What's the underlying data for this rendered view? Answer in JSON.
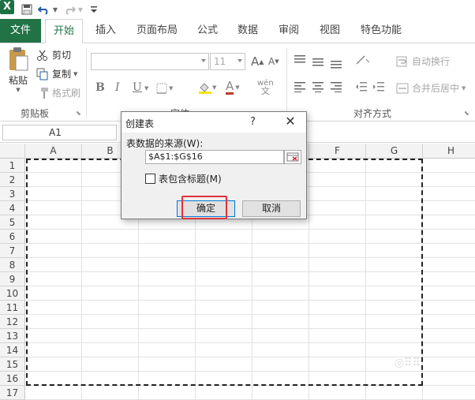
{
  "app": {
    "logo_letter": "X"
  },
  "qat": {
    "undo_icon": "undo-icon",
    "redo_icon": "redo-icon"
  },
  "tabs": [
    {
      "id": "file",
      "label": "文件"
    },
    {
      "id": "home",
      "label": "开始"
    },
    {
      "id": "insert",
      "label": "插入"
    },
    {
      "id": "layout",
      "label": "页面布局"
    },
    {
      "id": "formula",
      "label": "公式"
    },
    {
      "id": "data",
      "label": "数据"
    },
    {
      "id": "review",
      "label": "审阅"
    },
    {
      "id": "view",
      "label": "视图"
    },
    {
      "id": "special",
      "label": "特色功能"
    }
  ],
  "ribbon": {
    "clipboard": {
      "paste": "粘贴",
      "cut": "剪切",
      "copy": "复制",
      "format_painter": "格式刷",
      "label": "剪贴板"
    },
    "font": {
      "size": "11",
      "bold": "B",
      "italic": "I",
      "underline": "U",
      "grow": "A",
      "shrink": "A",
      "font_color": "A",
      "wen": "wén",
      "label": "字体"
    },
    "alignment": {
      "wrap": "自动换行",
      "merge": "合并后居中",
      "label": "对齐方式"
    }
  },
  "formula_bar": {
    "name_box": "A1"
  },
  "grid": {
    "columns": [
      "A",
      "B",
      "C",
      "D",
      "E",
      "F",
      "G",
      "H"
    ],
    "rows": [
      "1",
      "2",
      "3",
      "4",
      "5",
      "6",
      "7",
      "8",
      "9",
      "10",
      "11",
      "12",
      "13",
      "14",
      "15",
      "16",
      "17"
    ]
  },
  "dialog": {
    "title": "创建表",
    "help": "?",
    "source_label": "表数据的来源(W):",
    "source_value": "$A$1:$G$16",
    "has_headers_label": "表包含标题(M)",
    "ok": "确定",
    "cancel": "取消"
  },
  "colors": {
    "accent": "#217346",
    "highlight": "#e0323a"
  }
}
